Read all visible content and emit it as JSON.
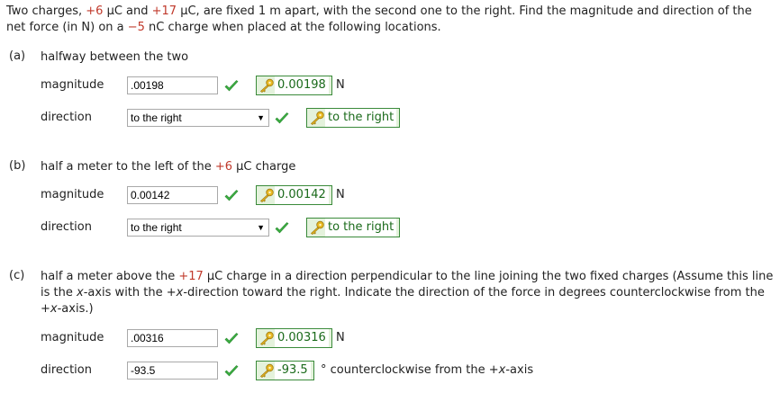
{
  "question": {
    "p1": "Two charges, ",
    "q1": "+6",
    "p2": " μC and ",
    "q2": "+17",
    "p3": " μC, are fixed 1 m apart, with the second one to the right. Find the magnitude and direction of the net force (in N) on a ",
    "q3": "−5",
    "p4": " nC charge when placed at the following locations."
  },
  "part_a": {
    "label": "(a)",
    "text": "halfway between the two",
    "magnitude_label": "magnitude",
    "magnitude_value": ".00198",
    "magnitude_answer": "0.00198",
    "magnitude_unit": "N",
    "direction_label": "direction",
    "direction_value": "to the right",
    "direction_answer": "to the right"
  },
  "part_b": {
    "label": "(b)",
    "text_pre": "half a meter to the left of the ",
    "text_charge": "+6",
    "text_post": " μC charge",
    "magnitude_label": "magnitude",
    "magnitude_value": "0.00142",
    "magnitude_answer": "0.00142",
    "magnitude_unit": "N",
    "direction_label": "direction",
    "direction_value": "to the right",
    "direction_answer": "to the right"
  },
  "part_c": {
    "label": "(c)",
    "t1": "half a meter above the ",
    "t_charge": "+17",
    "t2": " μC charge in a direction perpendicular to the line joining the two fixed charges (Assume this line is the ",
    "t_x1": "x",
    "t3": "-axis with the +",
    "t_x2": "x",
    "t4": "-direction toward the right. Indicate the direction of the force in degrees counterclockwise from the +",
    "t_x3": "x",
    "t5": "-axis.)",
    "magnitude_label": "magnitude",
    "magnitude_value": ".00316",
    "magnitude_answer": "0.00316",
    "magnitude_unit": "N",
    "direction_label": "direction",
    "direction_value": "-93.5",
    "direction_answer": "-93.5",
    "direction_unit_pre": "° counterclockwise from the +",
    "direction_unit_x": "x",
    "direction_unit_post": "-axis"
  },
  "icons": {
    "check": "checkmark-icon",
    "key": "key-icon",
    "dropdown": "chevron-down-icon"
  },
  "colors": {
    "answer_border": "#3a8a3a",
    "answer_bg": "#e4f2dc",
    "check": "#3cb043",
    "charge_red": "#c0392b"
  }
}
